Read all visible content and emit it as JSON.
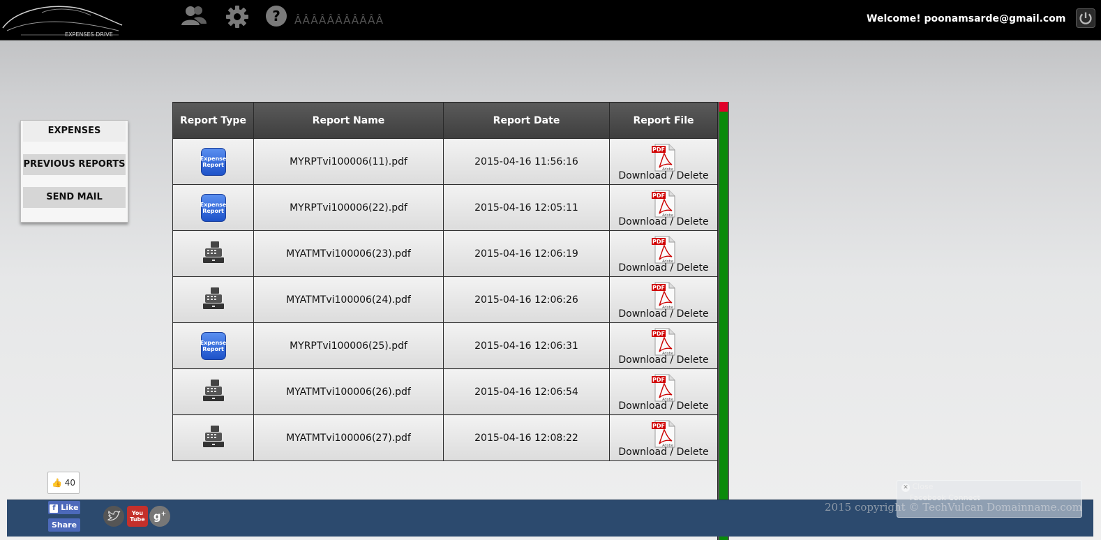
{
  "header": {
    "logo_text": "EXPENSES DRIVE",
    "garbled_text": "ÂÂÂÂÂÂÂÂÂÂÂ",
    "welcome": "Welcome! poonamsarde@gmail.com"
  },
  "sidebar": {
    "items": [
      {
        "label": "EXPENSES"
      },
      {
        "label": "PREVIOUS REPORTS"
      },
      {
        "label": "SEND MAIL"
      }
    ]
  },
  "table": {
    "headers": [
      "Report Type",
      "Report Name",
      "Report Date",
      "Report File"
    ],
    "rows": [
      {
        "type": "expense",
        "name": "MYRPTvi100006(11).pdf",
        "date": "2015-04-16 11:56:16"
      },
      {
        "type": "expense",
        "name": "MYRPTvi100006(22).pdf",
        "date": "2015-04-16 12:05:11"
      },
      {
        "type": "atm",
        "name": "MYATMTvi100006(23).pdf",
        "date": "2015-04-16 12:06:19"
      },
      {
        "type": "atm",
        "name": "MYATMTvi100006(24).pdf",
        "date": "2015-04-16 12:06:26"
      },
      {
        "type": "expense",
        "name": "MYRPTvi100006(25).pdf",
        "date": "2015-04-16 12:06:31"
      },
      {
        "type": "atm",
        "name": "MYATMTvi100006(26).pdf",
        "date": "2015-04-16 12:06:54"
      },
      {
        "type": "atm",
        "name": "MYATMTvi100006(27).pdf",
        "date": "2015-04-16 12:08:22"
      }
    ],
    "download_label": "Download",
    "separator": " / ",
    "delete_label": "Delete",
    "expense_icon_text": "Expense Report",
    "pdf_label": "PDF",
    "adobe_label": "Adobe"
  },
  "footer": {
    "like_count": "40",
    "like_label": "Like",
    "share_label": "Share",
    "copyright": "2015 copyright © TechVulcan Domainname.com",
    "popup_close": "Close",
    "popup_title": "Facebook Connect",
    "youtube_label": "You Tube"
  },
  "colors": {
    "topbar": "#000000",
    "footer": "#2c4a6e",
    "scroll_thumb": "#0a8a0a",
    "scroll_cap": "#e0002a",
    "expense_icon": "#2a62d8",
    "facebook": "#4c69ba"
  }
}
